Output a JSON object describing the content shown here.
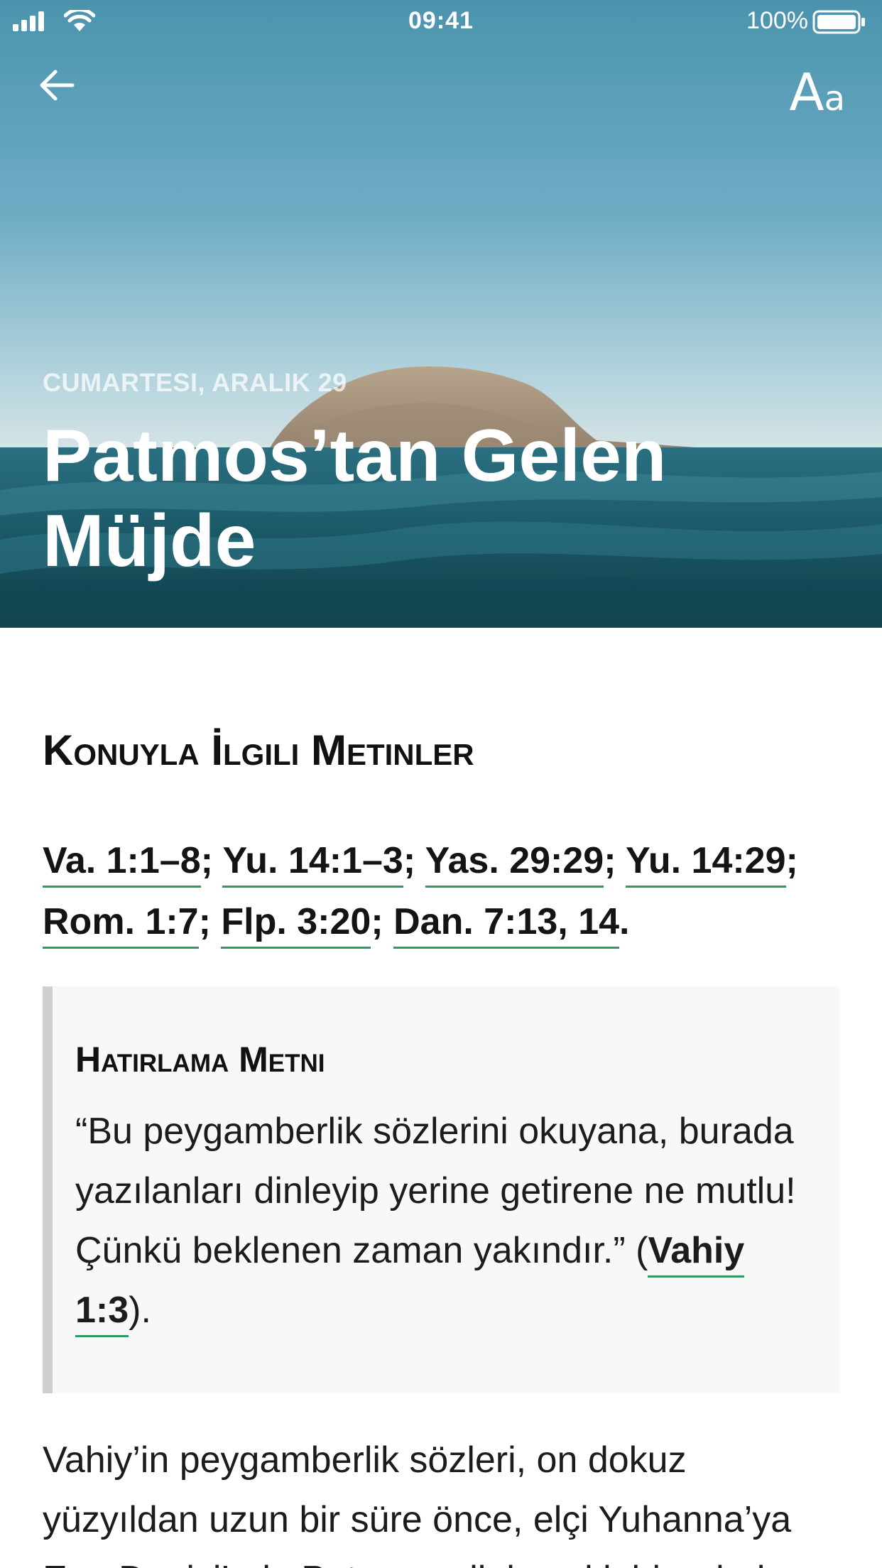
{
  "status_bar": {
    "time": "09:41",
    "battery": "100%"
  },
  "toolbar": {
    "back_icon": "arrow-left-icon",
    "font_size_big": "A",
    "font_size_small": "a"
  },
  "hero": {
    "date": "CUMARTESI, ARALIK 29",
    "title": "Patmos’tan Gelen Müjde"
  },
  "related_texts": {
    "heading": "Konuyla İlgili Metinler",
    "refs": [
      "Va. 1:1–8",
      "Yu. 14:1–3",
      "Yas. 29:29",
      "Yu. 14:29",
      "Rom. 1:7",
      "Flp. 3:20",
      "Dan. 7:13, 14"
    ],
    "separator": "; ",
    "end": "."
  },
  "memory_verse": {
    "heading": "Hatırlama Metni",
    "text": "“Bu peygamberlik sözlerini okuyana, burada yazılanları dinleyip yerine getirene ne mutlu! Çünkü beklenen zaman yakındır.” (",
    "ref": "Vahiy 1:3",
    "end": ")."
  },
  "body": {
    "text": "Vahiy’in peygamberlik sözleri, on dokuz yüzyıldan uzun bir süre önce, elçi Yuhanna’ya Ege Denizi’nde Patmos adlı kayalık bir adada"
  },
  "colors": {
    "link_underline": "#2e9a5f",
    "quote_bar": "#cfcfcf",
    "quote_bg": "#f8f8f8"
  }
}
